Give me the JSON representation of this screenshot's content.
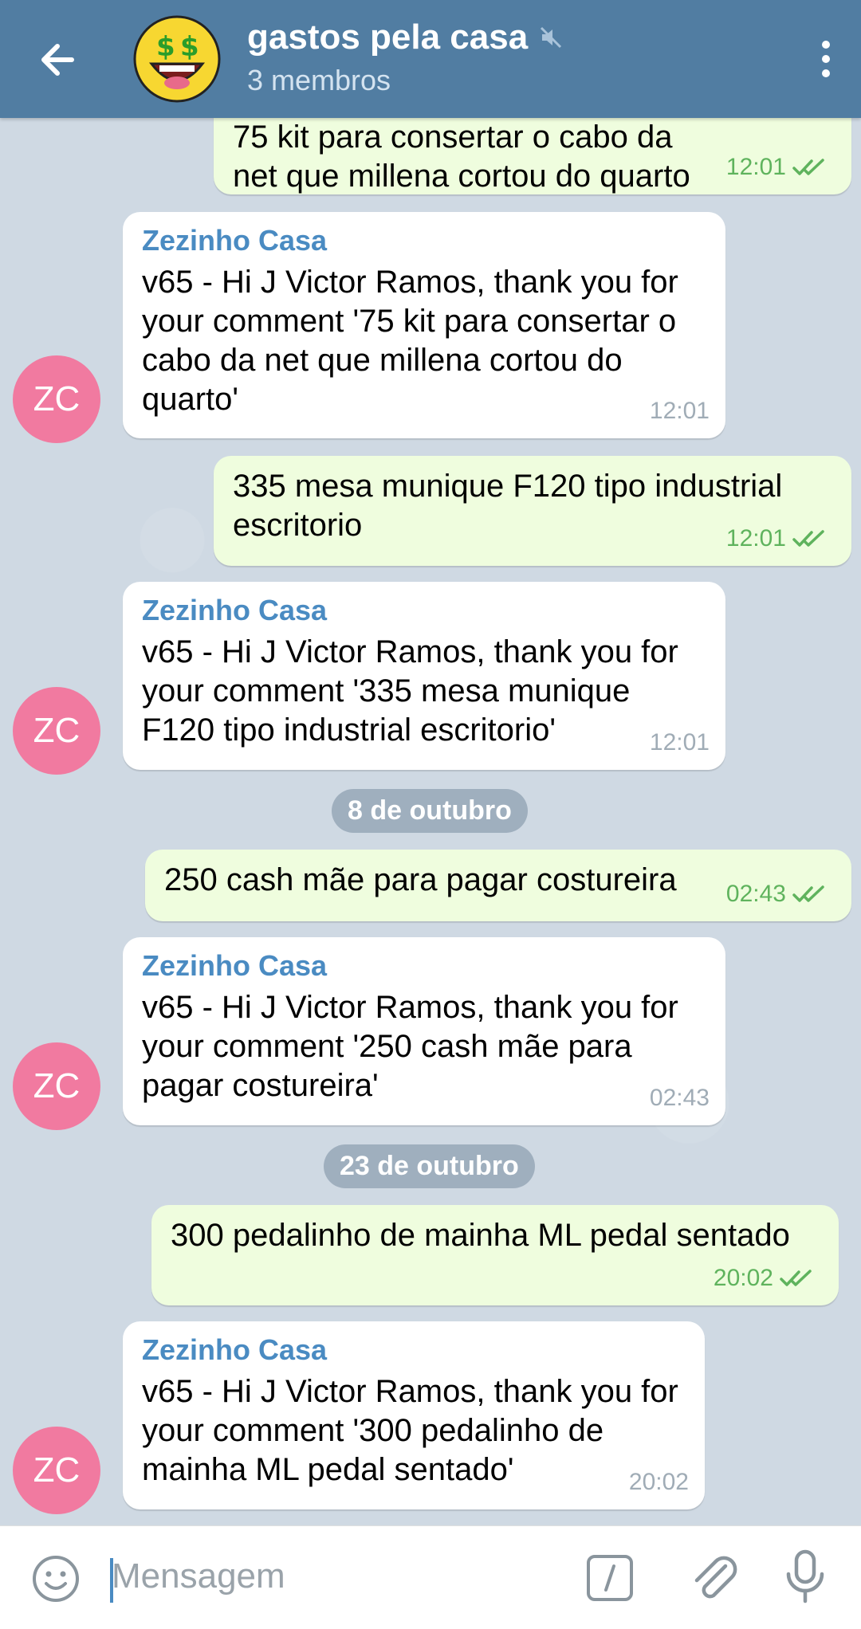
{
  "header": {
    "title": "gastos pela casa",
    "subtitle": "3 membros",
    "back_icon": "arrow-left-icon",
    "mute_icon": "muted-speaker-icon",
    "more_icon": "more-vertical-icon",
    "avatar": "money-face-emoji-avatar"
  },
  "messages": [
    {
      "type": "out",
      "text": "75 kit para consertar o cabo da net que millena cortou do quarto",
      "time": "12:01"
    },
    {
      "type": "in",
      "sender": "Zezinho Casa",
      "text": "v65 - Hi J Victor Ramos, thank you for your comment '75 kit para consertar o cabo da net que millena cortou do quarto'",
      "time": "12:01",
      "avatar": "ZC"
    },
    {
      "type": "out",
      "text": "335 mesa munique F120 tipo industrial escritorio",
      "time": "12:01"
    },
    {
      "type": "in",
      "sender": "Zezinho Casa",
      "text": "v65 - Hi J Victor Ramos, thank you for your comment '335 mesa munique F120 tipo industrial escritorio'",
      "time": "12:01",
      "avatar": "ZC"
    },
    {
      "type": "date",
      "text": "8 de outubro"
    },
    {
      "type": "out",
      "text": "250 cash mãe para pagar costureira",
      "time": "02:43"
    },
    {
      "type": "in",
      "sender": "Zezinho Casa",
      "text": "v65 - Hi J Victor Ramos, thank you for your comment '250 cash mãe para pagar costureira'",
      "time": "02:43",
      "avatar": "ZC"
    },
    {
      "type": "date",
      "text": "23 de outubro"
    },
    {
      "type": "out",
      "text": "300 pedalinho de mainha ML pedal sentado",
      "time": "20:02"
    },
    {
      "type": "in",
      "sender": "Zezinho Casa",
      "text": "v65 - Hi J Victor Ramos, thank you for your comment '300 pedalinho de mainha ML pedal sentado'",
      "time": "20:02",
      "avatar": "ZC"
    }
  ],
  "input": {
    "placeholder": "Mensagem",
    "emoji_icon": "smiley-icon",
    "command_icon": "slash-command-icon",
    "attach_icon": "paperclip-icon",
    "mic_icon": "microphone-icon"
  },
  "colors": {
    "header": "#517da2",
    "outgoing_bubble": "#effdde",
    "incoming_bubble": "#ffffff",
    "sender_name": "#4a8bc2",
    "read_check": "#5fb35d",
    "avatar_bg": "#f17aa0"
  }
}
